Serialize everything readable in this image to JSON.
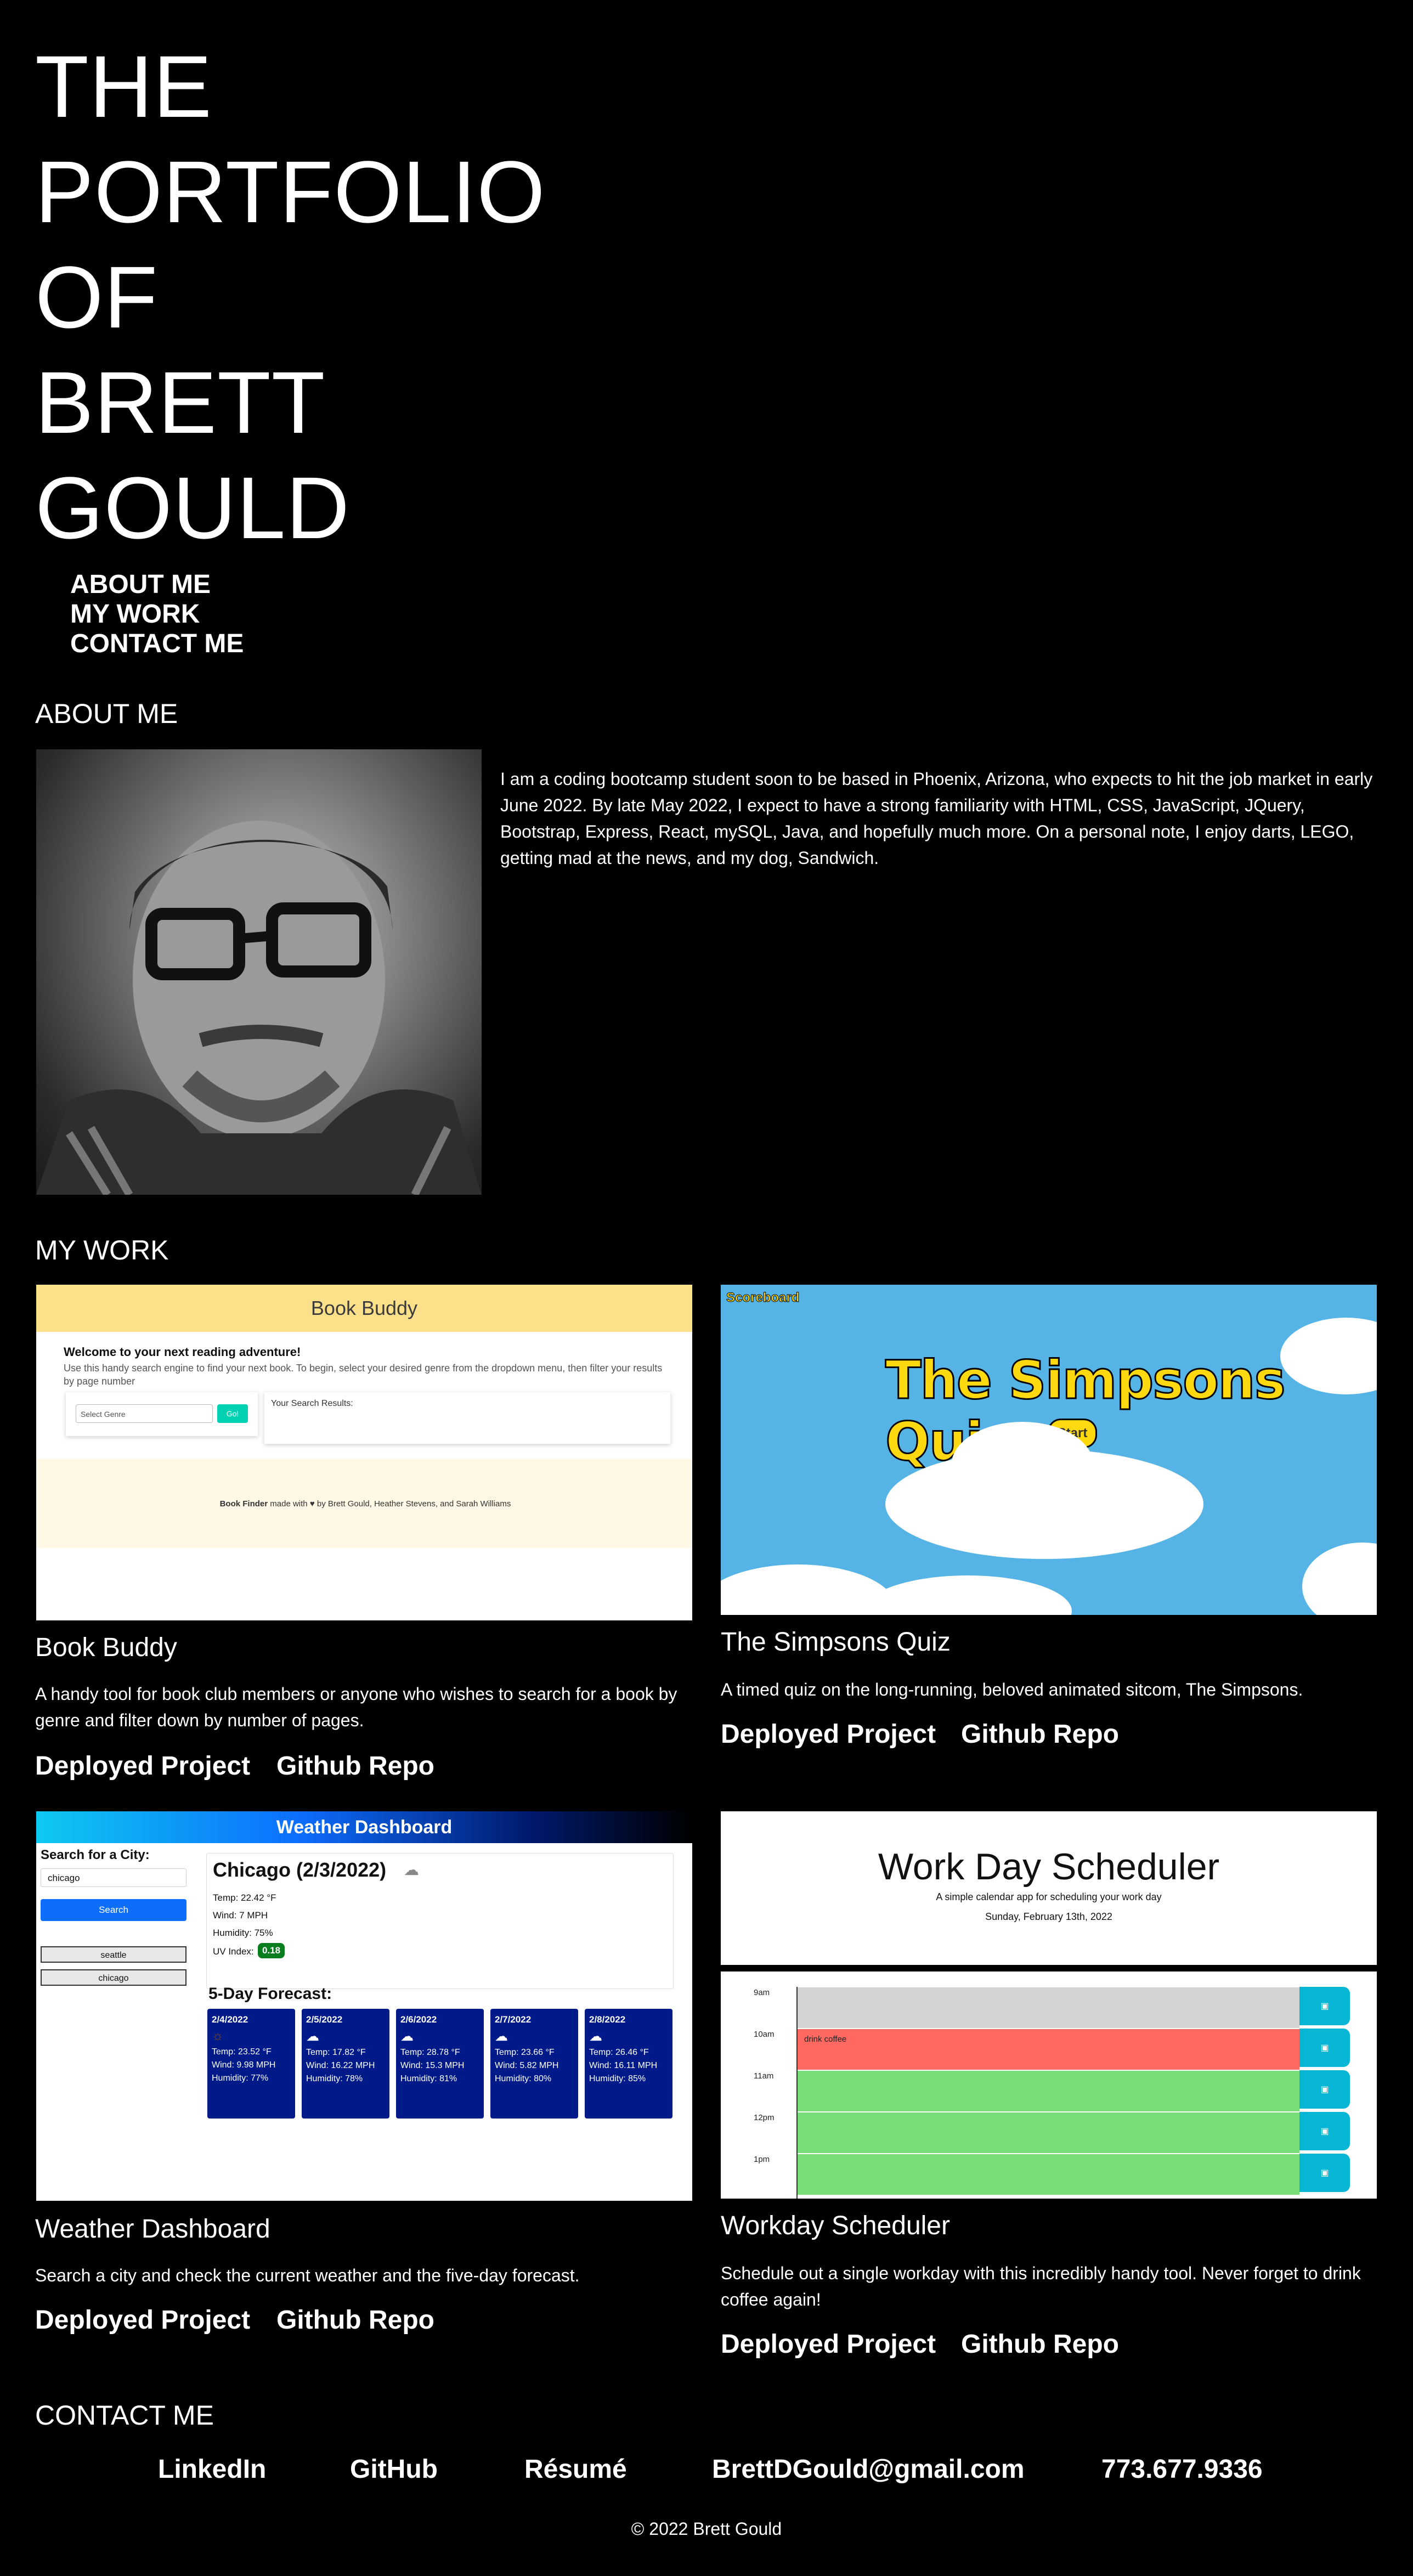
{
  "hero": {
    "line1": "THE",
    "line2": "PORTFOLIO",
    "line3": "OF",
    "line4": "BRETT",
    "line5": "GOULD"
  },
  "nav": {
    "about": "ABOUT ME",
    "work": "MY WORK",
    "contact": "CONTACT ME"
  },
  "about": {
    "heading": "ABOUT ME",
    "text": "I am a coding bootcamp student soon to be based in Phoenix, Arizona, who expects to hit the job market in early June 2022. By late May 2022, I expect to have a strong familiarity with HTML, CSS, JavaScript, JQuery, Bootstrap, Express, React, mySQL, Java, and hopefully much more. On a personal note, I enjoy darts, LEGO, getting mad at the news, and my dog, Sandwich."
  },
  "work": {
    "heading": "MY WORK",
    "deployed_label": "Deployed Project",
    "repo_label": "Github Repo",
    "projects": [
      {
        "title": "Book Buddy",
        "description": "A handy tool for book club members or anyone who wishes to search for a book by genre and filter down by number of pages.",
        "shot": {
          "header": "Book Buddy",
          "welcome": "Welcome to your next reading adventure!",
          "desc": "Use this handy search engine to find your next book. To begin, select your desired genre from the dropdown menu, then filter your results by page number",
          "select": "Select Genre",
          "go": "Go!",
          "results": "Your Search Results:",
          "footer_bold": "Book Finder",
          "footer_rest": "made with ♥ by Brett Gould, Heather Stevens, and Sarah Williams"
        }
      },
      {
        "title": "The Simpsons Quiz",
        "description": "A timed quiz on the long-running, beloved animated sitcom, The Simpsons.",
        "shot": {
          "scoreboard": "Scoreboard",
          "title": "The Simpsons Quiz",
          "start": "Start"
        }
      },
      {
        "title": "Weather Dashboard",
        "description": "Search a city and check the current weather and the five-day forecast.",
        "shot": {
          "banner": "Weather Dashboard",
          "search_label": "Search for a City:",
          "search_value": "chicago",
          "search_button": "Search",
          "history": [
            "seattle",
            "chicago"
          ],
          "city": "Chicago (2/3/2022)",
          "temp": "Temp: 22.42 °F",
          "wind": "Wind: 7 MPH",
          "humidity": "Humidity: 75%",
          "uv_label": "UV Index:",
          "uv_value": "0.18",
          "forecast_title": "5-Day Forecast:",
          "forecast": [
            {
              "date": "2/4/2022",
              "temp": "Temp: 23.52 °F",
              "wind": "Wind: 9.98 MPH",
              "humidity": "Humidity: 77%"
            },
            {
              "date": "2/5/2022",
              "temp": "Temp: 17.82 °F",
              "wind": "Wind: 16.22 MPH",
              "humidity": "Humidity: 78%"
            },
            {
              "date": "2/6/2022",
              "temp": "Temp: 28.78 °F",
              "wind": "Wind: 15.3 MPH",
              "humidity": "Humidity: 81%"
            },
            {
              "date": "2/7/2022",
              "temp": "Temp: 23.66 °F",
              "wind": "Wind: 5.82 MPH",
              "humidity": "Humidity: 80%"
            },
            {
              "date": "2/8/2022",
              "temp": "Temp: 26.46 °F",
              "wind": "Wind: 16.11 MPH",
              "humidity": "Humidity: 85%"
            }
          ]
        }
      },
      {
        "title": "Workday Scheduler",
        "description": "Schedule out a single workday with this incredibly handy tool. Never forget to drink coffee again!",
        "shot": {
          "title": "Work Day Scheduler",
          "subtitle": "A simple calendar app for scheduling your work day",
          "date": "Sunday, February 13th, 2022",
          "hours": [
            "9am",
            "10am",
            "11am",
            "12pm",
            "1pm"
          ],
          "entry": "drink coffee"
        }
      }
    ]
  },
  "contact": {
    "heading": "CONTACT ME",
    "linkedin": "LinkedIn",
    "github": "GitHub",
    "resume": "Résumé",
    "email": "BrettDGould@gmail.com",
    "phone": "773.677.9336"
  },
  "footer": "© 2022 Brett Gould"
}
